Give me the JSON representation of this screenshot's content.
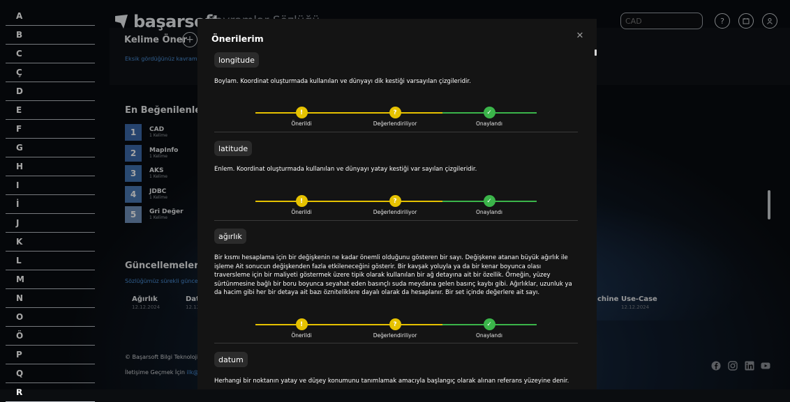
{
  "alphabet": [
    "A",
    "B",
    "C",
    "Ç",
    "D",
    "E",
    "F",
    "G",
    "H",
    "I",
    "İ",
    "J",
    "K",
    "L",
    "M",
    "N",
    "O",
    "Ö",
    "P",
    "Q",
    "R"
  ],
  "brand": {
    "logo_text": "başarsoft",
    "page_title": "Kavramlar Sözlüğü"
  },
  "header": {
    "search_placeholder": "CAD"
  },
  "suggest": {
    "title": "Kelime Öner",
    "subtitle": "Eksik gördüğünüz kavramla"
  },
  "top_liked": {
    "title": "En Beğenilenler",
    "items": [
      {
        "rank": "1",
        "name": "CAD",
        "count": "1 Kelime"
      },
      {
        "rank": "2",
        "name": "MapInfo",
        "count": "1 Kelime"
      },
      {
        "rank": "3",
        "name": "AKS",
        "count": "1 Kelime"
      },
      {
        "rank": "4",
        "name": "JDBC",
        "count": "1 Kelime"
      },
      {
        "rank": "5",
        "name": "Gri Değer",
        "count": "1 Kelime"
      }
    ]
  },
  "updates": {
    "title": "Güncellemeler",
    "subtitle": "Sözlüğümüz sürekli güncel",
    "items": [
      {
        "name": "Ağırlık",
        "date": "12.12.2024"
      },
      {
        "name": "Dat",
        "date": "12.12"
      },
      {
        "name": "chine",
        "date": ""
      },
      {
        "name": "Use-Case",
        "date": "12.12.2024"
      }
    ]
  },
  "footer": {
    "copyright": "© Başarsoft Bilgi Teknoloji",
    "contact_label": "İletişime Geçmek İçin",
    "contact_link": "ilk@b"
  },
  "modal": {
    "title": "Önerilerim",
    "steps": [
      "Önerildi",
      "Değerlendiriliyor",
      "Onaylandı"
    ],
    "step_icons": [
      "!",
      "?",
      "✓"
    ],
    "terms": [
      {
        "term": "longitude",
        "description": "Boylam. Koordinat oluşturmada kullanılan ve dünyayı dik kestiği varsayılan çizgileridir."
      },
      {
        "term": "latitude",
        "description": "Enlem. Koordinat oluşturmada kullanılan ve dünyayı yatay kestiği var sayılan çizgileridir."
      },
      {
        "term": "ağırlık",
        "description": "Bir kısmı hesaplama için bir değişkenin ne kadar önemli olduğunu gösteren bir sayı. Değişkene atanan büyük ağırlık ile işleme Ait sonucun değişkenden fazla etkileneceğini gösterir. Bir kavşak yoluyla ya da bir kenar boyunca olası traversleme için bir maliyeti göstermek üzere tipik olarak kullanılan bir ağ detayına ait bir özellik. Örneğin, yüzey sürtünmesine bağlı bir boru boyunca seyahat eden basınçlı suda meydana gelen basınç kaybı gibi. Ağırlıklar, uzunluk ya da hacim gibi her bir detaya ait bazı özniteliklere dayalı olarak da hesaplanır. Bir set içinde değerlere ait sayı."
      },
      {
        "term": "datum",
        "description": "Herhangi bir noktanın yatay ve düşey konumunu tanımlamak amacıyla başlangıç olarak alınan referans yüzeyine denir."
      }
    ]
  },
  "colors": {
    "accent_blue": "#3b67a8",
    "link_blue": "#4a90d9",
    "step_yellow": "#e6c200",
    "step_green": "#3bb54a"
  }
}
